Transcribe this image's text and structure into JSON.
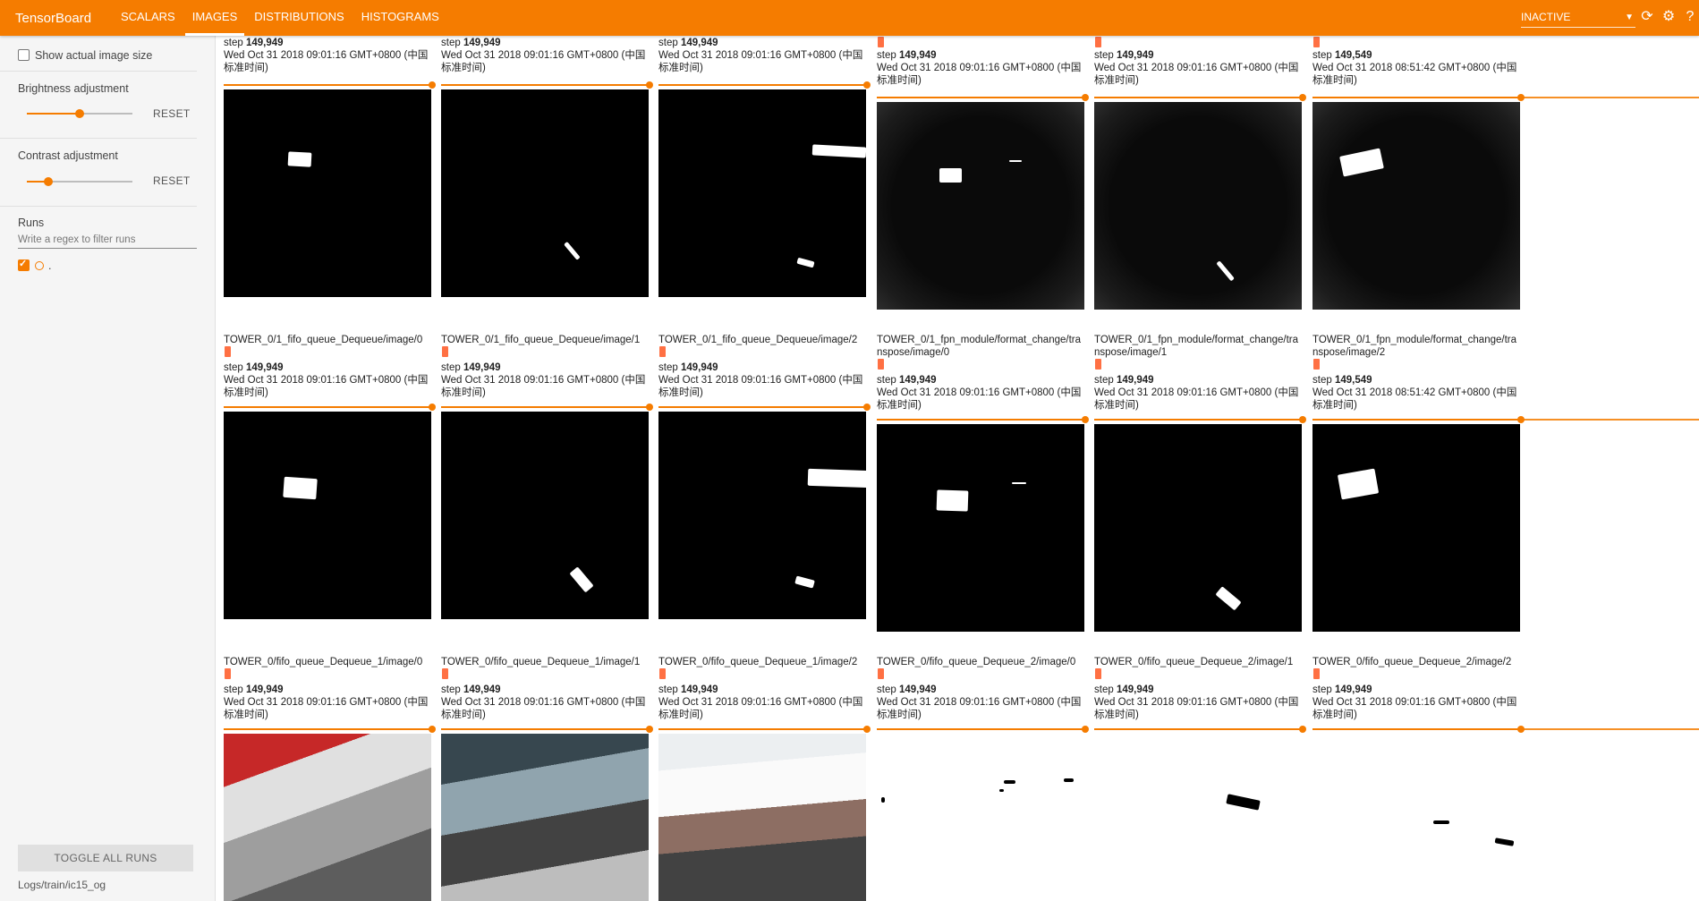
{
  "app": {
    "title": "TensorBoard"
  },
  "tabs": [
    {
      "label": "SCALARS",
      "active": false
    },
    {
      "label": "IMAGES",
      "active": true
    },
    {
      "label": "DISTRIBUTIONS",
      "active": false
    },
    {
      "label": "HISTOGRAMS",
      "active": false
    }
  ],
  "header": {
    "status": "INACTIVE",
    "icons": [
      "refresh-icon",
      "settings-icon",
      "help-icon"
    ]
  },
  "sidebar": {
    "show_actual_size": "Show actual image size",
    "brightness_label": "Brightness adjustment",
    "brightness_value": 0.5,
    "contrast_label": "Contrast adjustment",
    "contrast_value": 0.2,
    "reset_label": "RESET",
    "runs_label": "Runs",
    "regex_placeholder": "Write a regex to filter runs",
    "run_name": ".",
    "toggle_label": "TOGGLE ALL RUNS",
    "logdir": "Logs/train/ic15_og"
  },
  "colors": {
    "accent": "#f57c00",
    "run_chip": "#ff7043"
  },
  "rows": [
    {
      "cards": [
        {
          "tag": "",
          "step": "149,949",
          "time": "Wed Oct 31 2018 09:01:16 GMT+0800 (中国标准时间)"
        },
        {
          "tag": "",
          "step": "149,949",
          "time": "Wed Oct 31 2018 09:01:16 GMT+0800 (中国标准时间)"
        },
        {
          "tag": "",
          "step": "149,949",
          "time": "Wed Oct 31 2018 09:01:16 GMT+0800 (中国标准时间)"
        },
        {
          "tag": "",
          "step": "149,949",
          "time": "Wed Oct 31 2018 09:01:16 GMT+0800 (中国标准时间)"
        },
        {
          "tag": "",
          "step": "149,949",
          "time": "Wed Oct 31 2018 09:01:16 GMT+0800 (中国标准时间)"
        },
        {
          "tag": "",
          "step": "149,549",
          "time": "Wed Oct 31 2018 08:51:42 GMT+0800 (中国标准时间)"
        }
      ]
    },
    {
      "cards": [
        {
          "tag": "TOWER_0/1_fifo_queue_Dequeue/image/0",
          "step": "149,949",
          "time": "Wed Oct 31 2018 09:01:16 GMT+0800 (中国标准时间)"
        },
        {
          "tag": "TOWER_0/1_fifo_queue_Dequeue/image/1",
          "step": "149,949",
          "time": "Wed Oct 31 2018 09:01:16 GMT+0800 (中国标准时间)"
        },
        {
          "tag": "TOWER_0/1_fifo_queue_Dequeue/image/2",
          "step": "149,949",
          "time": "Wed Oct 31 2018 09:01:16 GMT+0800 (中国标准时间)"
        },
        {
          "tag": "TOWER_0/1_fpn_module/format_change/transpose/image/0",
          "step": "149,949",
          "time": "Wed Oct 31 2018 09:01:16 GMT+0800 (中国标准时间)"
        },
        {
          "tag": "TOWER_0/1_fpn_module/format_change/transpose/image/1",
          "step": "149,949",
          "time": "Wed Oct 31 2018 09:01:16 GMT+0800 (中国标准时间)"
        },
        {
          "tag": "TOWER_0/1_fpn_module/format_change/transpose/image/2",
          "step": "149,549",
          "time": "Wed Oct 31 2018 08:51:42 GMT+0800 (中国标准时间)"
        }
      ]
    },
    {
      "cards": [
        {
          "tag": "TOWER_0/fifo_queue_Dequeue_1/image/0",
          "step": "149,949",
          "time": "Wed Oct 31 2018 09:01:16 GMT+0800 (中国标准时间)"
        },
        {
          "tag": "TOWER_0/fifo_queue_Dequeue_1/image/1",
          "step": "149,949",
          "time": "Wed Oct 31 2018 09:01:16 GMT+0800 (中国标准时间)"
        },
        {
          "tag": "TOWER_0/fifo_queue_Dequeue_1/image/2",
          "step": "149,949",
          "time": "Wed Oct 31 2018 09:01:16 GMT+0800 (中国标准时间)"
        },
        {
          "tag": "TOWER_0/fifo_queue_Dequeue_2/image/0",
          "step": "149,949",
          "time": "Wed Oct 31 2018 09:01:16 GMT+0800 (中国标准时间)"
        },
        {
          "tag": "TOWER_0/fifo_queue_Dequeue_2/image/1",
          "step": "149,949",
          "time": "Wed Oct 31 2018 09:01:16 GMT+0800 (中国标准时间)"
        },
        {
          "tag": "TOWER_0/fifo_queue_Dequeue_2/image/2",
          "step": "149,949",
          "time": "Wed Oct 31 2018 09:01:16 GMT+0800 (中国标准时间)"
        }
      ]
    }
  ],
  "step_prefix": "step"
}
